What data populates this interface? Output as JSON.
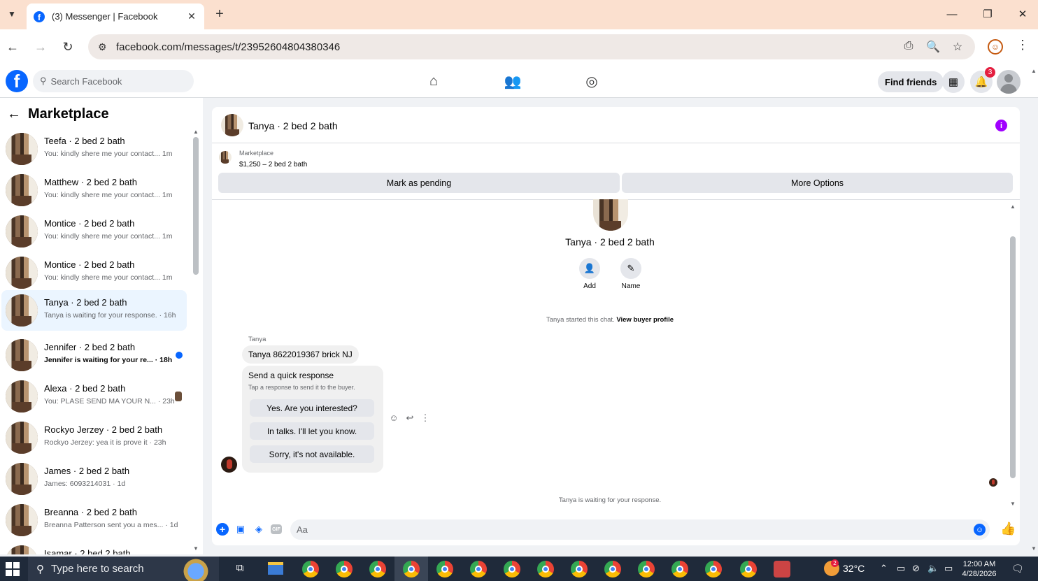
{
  "browser": {
    "tab_title": "(3) Messenger | Facebook",
    "url": "facebook.com/messages/t/23952604804380346",
    "tab_menu_icon": "chevron-down-icon",
    "new_tab_label": "+",
    "minimize": "—",
    "restore": "❐",
    "close": "✕"
  },
  "fb": {
    "logo_letter": "f",
    "search_placeholder": "Search Facebook",
    "find_friends_label": "Find friends",
    "notification_count": "3"
  },
  "sidebar": {
    "title": "Marketplace",
    "conversations": [
      {
        "name": "Teefa · 2 bed 2 bath",
        "snippet": "You: kindly shere me your contact...  1m",
        "active": false,
        "unread": false
      },
      {
        "name": "Matthew · 2 bed 2 bath",
        "snippet": "You: kindly shere me your contact...  1m",
        "active": false,
        "unread": false
      },
      {
        "name": "Montice · 2 bed 2 bath",
        "snippet": "You: kindly shere me your contact...  1m",
        "active": false,
        "unread": false
      },
      {
        "name": "Montice · 2 bed 2 bath",
        "snippet": "You: kindly shere me your contact...  1m",
        "active": false,
        "unread": false
      },
      {
        "name": "Tanya · 2 bed 2 bath",
        "snippet": "Tanya is waiting for your response. · 16h",
        "active": true,
        "unread": false
      },
      {
        "name": "Jennifer · 2 bed 2 bath",
        "snippet": "Jennifer is waiting for your re... · 18h",
        "active": false,
        "unread": true
      },
      {
        "name": "Alexa · 2 bed 2 bath",
        "snippet": "You: PLASE SEND MA YOUR N... · 23h",
        "active": false,
        "unread": false
      },
      {
        "name": "Rockyo Jerzey · 2 bed 2 bath",
        "snippet": "Rockyo Jerzey: yea it is prove it · 23h",
        "active": false,
        "unread": false
      },
      {
        "name": "James · 2 bed 2 bath",
        "snippet": "James: 6093214031 · 1d",
        "active": false,
        "unread": false
      },
      {
        "name": "Breanna · 2 bed 2 bath",
        "snippet": "Breanna Patterson sent you a mes... · 1d",
        "active": false,
        "unread": false
      },
      {
        "name": "Isamar · 2 bed 2 bath",
        "snippet": "",
        "active": false,
        "unread": false
      }
    ]
  },
  "chat": {
    "title": "Tanya · 2 bed 2 bath",
    "marketplace_label": "Marketplace",
    "listing": "$1,250 – 2 bed 2 bath",
    "mark_pending_label": "Mark as pending",
    "more_options_label": "More Options",
    "profile_name": "Tanya · 2 bed 2 bath",
    "add_label": "Add",
    "name_label": "Name",
    "started_text": "Tanya started this chat.",
    "view_profile_label": "View buyer profile",
    "sender": "Tanya",
    "message": "Tanya 8622019367 brick NJ",
    "quick_title": "Send a quick response",
    "quick_sub": "Tap a response to send it to the buyer.",
    "quick_responses": [
      "Yes. Are you interested?",
      "In talks. I'll let you know.",
      "Sorry, it's not available."
    ],
    "waiting_text": "Tanya is waiting for your response.",
    "compose_placeholder": "Aa"
  },
  "taskbar": {
    "search_placeholder": "Type here to search",
    "temperature": "32°C",
    "weather_badge": "2",
    "time": "12:00 AM",
    "date": "4/28/2026"
  }
}
